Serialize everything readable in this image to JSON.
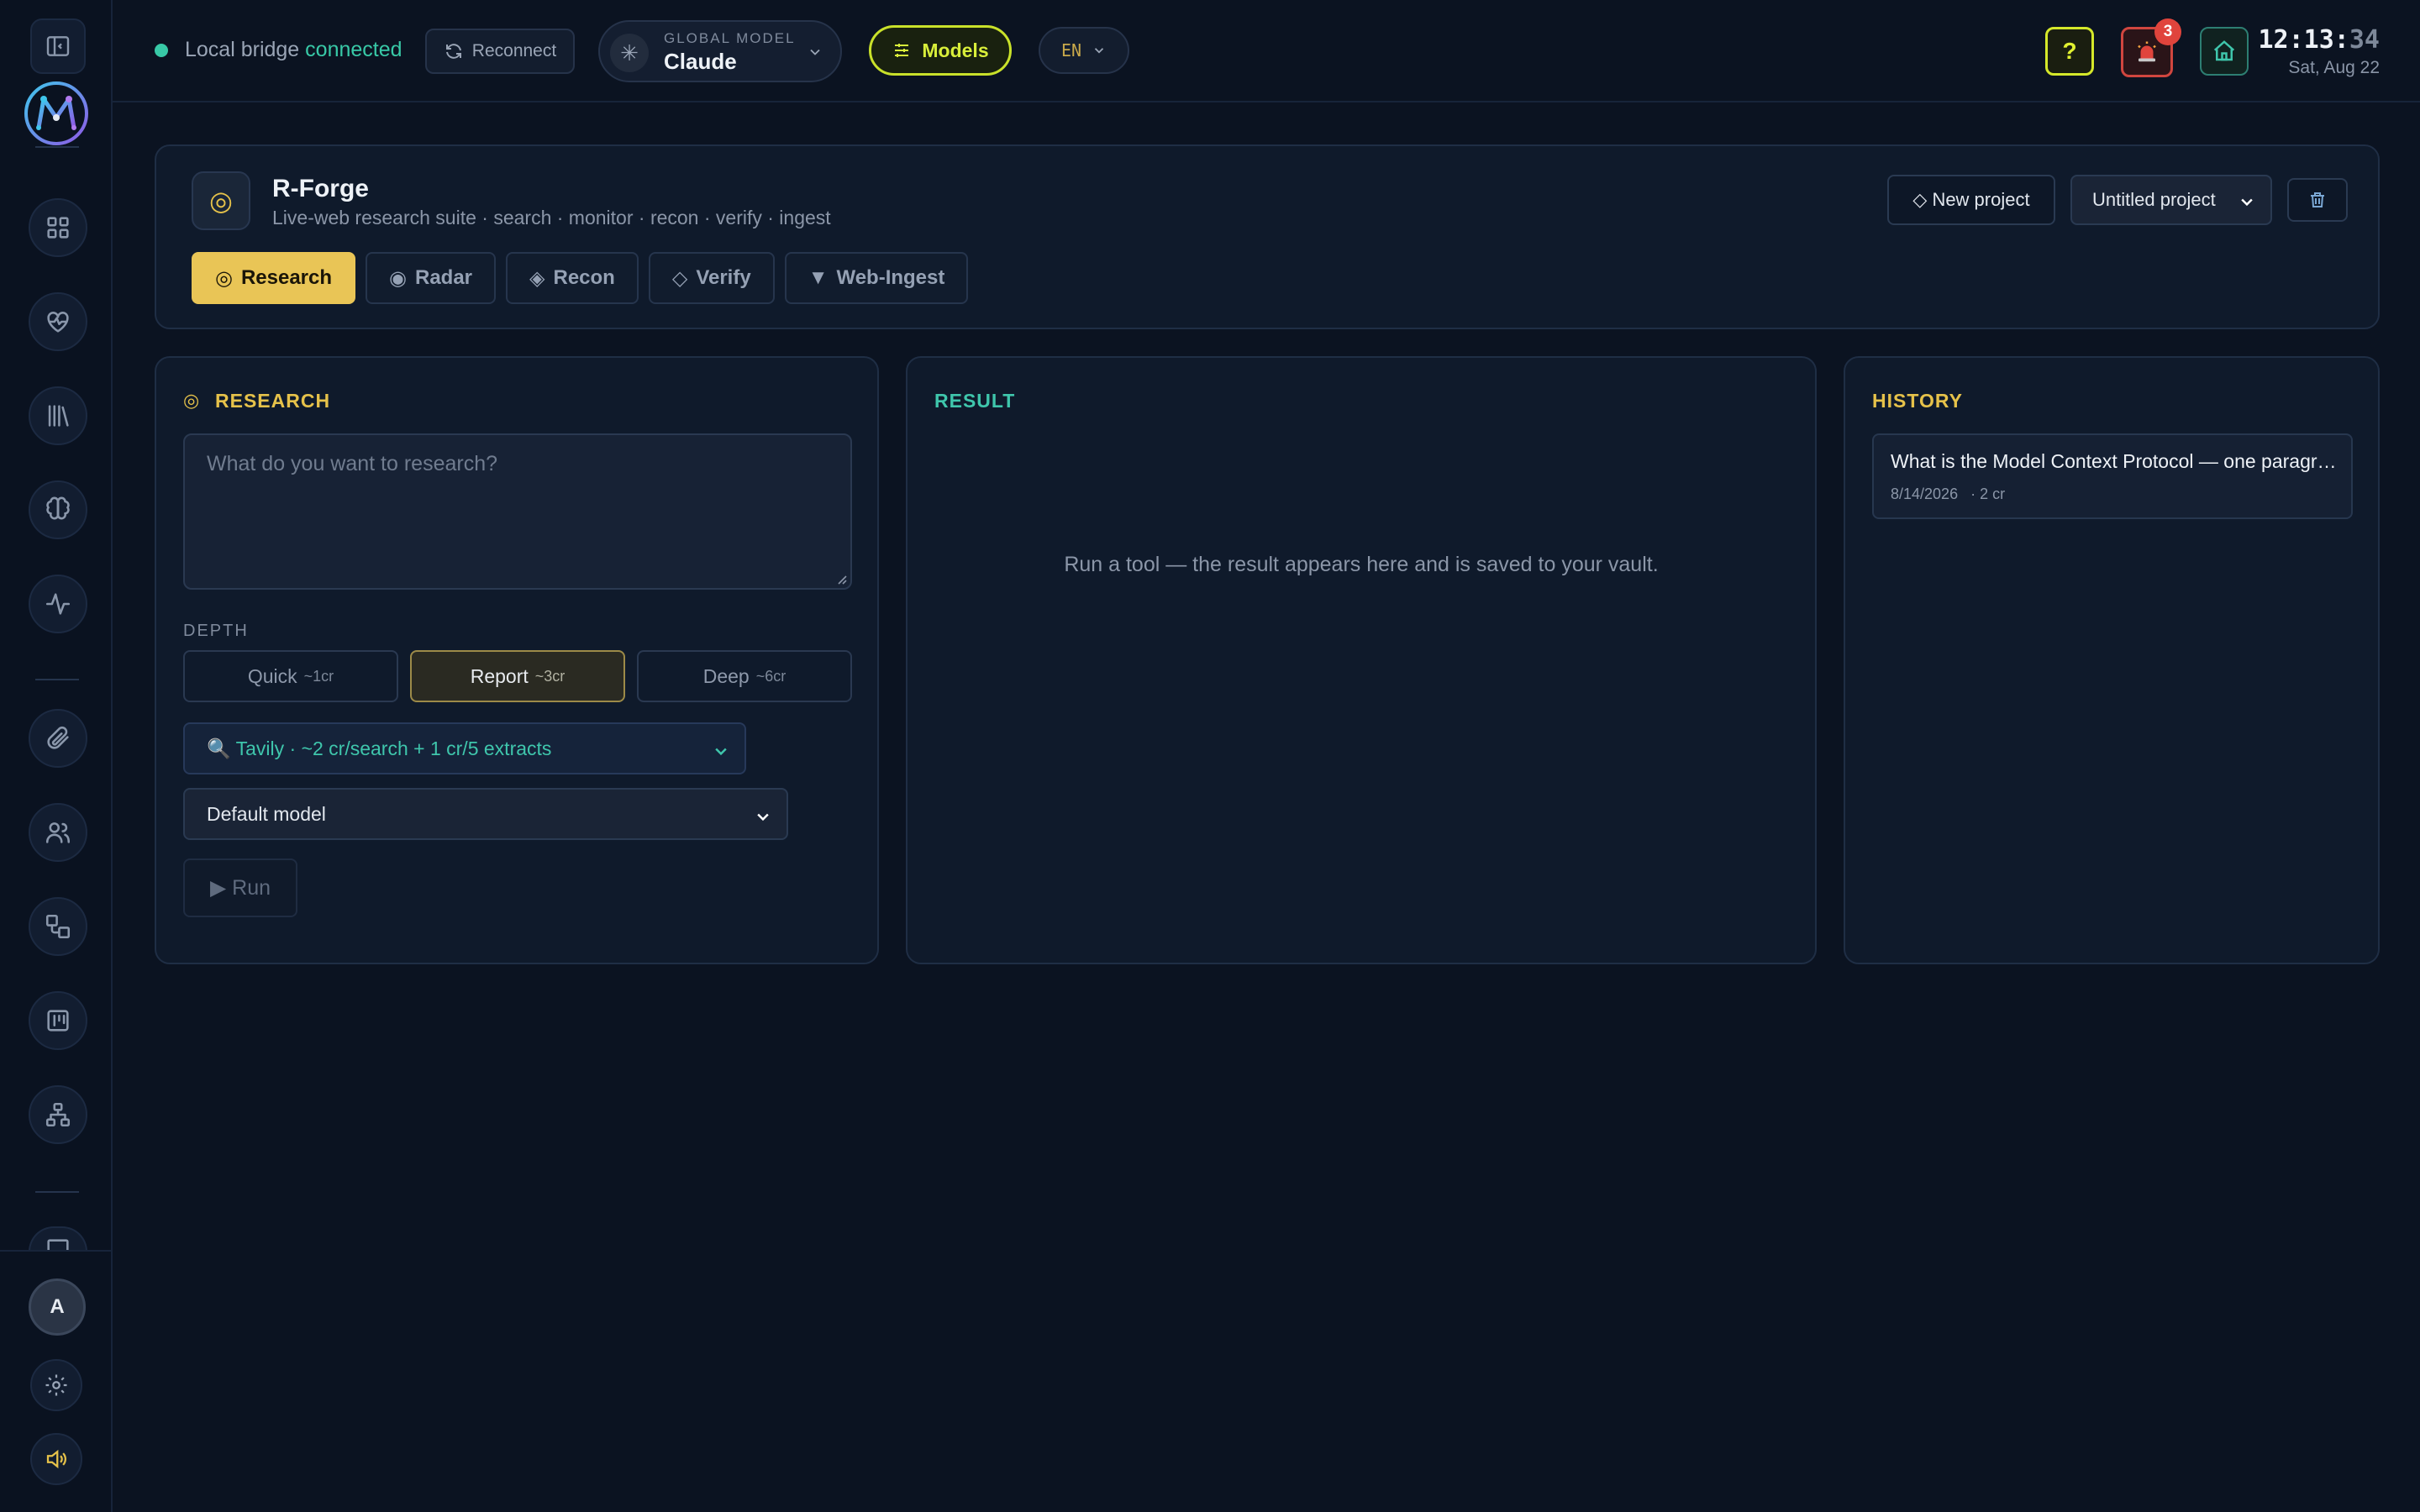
{
  "topbar": {
    "status_prefix": "Local bridge",
    "status_state": "connected",
    "reconnect_label": "Reconnect",
    "global_model_label": "GLOBAL MODEL",
    "global_model_value": "Claude",
    "models_label": "Models",
    "lang": "EN",
    "help_label": "?",
    "alert_count": "3",
    "clock_hm": "12:13:",
    "clock_s": "34",
    "date": "Sat, Aug 22"
  },
  "rail": {
    "avatar_initial": "A"
  },
  "header": {
    "title": "R-Forge",
    "subtitle": "Live-web research suite · search · monitor · recon · verify · ingest",
    "new_project_label": "◇ New project",
    "project_select": "Untitled project",
    "tabs": [
      {
        "icon": "◎",
        "label": "Research"
      },
      {
        "icon": "◉",
        "label": "Radar"
      },
      {
        "icon": "◈",
        "label": "Recon"
      },
      {
        "icon": "◇",
        "label": "Verify"
      },
      {
        "icon": "▼",
        "label": "Web-Ingest"
      }
    ]
  },
  "research": {
    "title": "RESEARCH",
    "input_placeholder": "What do you want to research?",
    "depth_label": "DEPTH",
    "depth_options": [
      {
        "label": "Quick",
        "cost": "~1cr"
      },
      {
        "label": "Report",
        "cost": "~3cr"
      },
      {
        "label": "Deep",
        "cost": "~6cr"
      }
    ],
    "search_provider": "🔍 Tavily · ~2 cr/search + 1 cr/5 extracts",
    "model_select": "Default model",
    "run_label": "▶ Run"
  },
  "result": {
    "title": "RESULT",
    "empty_message": "Run a tool — the result appears here and is saved to your vault."
  },
  "history": {
    "title": "HISTORY",
    "items": [
      {
        "query": "What is the Model Context Protocol — one paragraph",
        "date": "8/14/2026",
        "cost": "· 2 cr"
      }
    ]
  },
  "colors": {
    "accent_yellow": "#e9c556",
    "accent_teal": "#3fc6ac",
    "accent_lime": "#d8ee3a",
    "alert_red": "#e0443c"
  }
}
